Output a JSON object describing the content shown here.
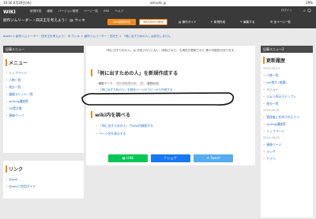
{
  "statusbar": {
    "time": "10:16  6月29日(木)",
    "url": "wikiwiki.jp",
    "battery": "29%"
  },
  "header": {
    "logo": "WIKI",
    "menu": [
      "新規作成",
      "編集",
      "バージョン管理",
      "ページ一覧",
      "RSS",
      "ヘルプ"
    ],
    "site_title": "創作ジムリーダー・四天王を考えよう！ @ ウィキ",
    "login": "ログイン",
    "btn_create": "wiki新規作成",
    "btn_manage": "無料版Wiki管理",
    "nav": [
      "操作ガイド",
      "新規作成",
      "編集する",
      "全ページ一覧"
    ]
  },
  "breadcrumb": "atwiki > 創作ジムリーダー・四天王を考えよう！ @ ウィキ > 創作ジムリーダー・四天王 > 「例に出すための人」は存在しません",
  "left_sidebar": {
    "head": "記事メニュー",
    "title": "メニュー",
    "items": [
      "トップページ",
      "人物一覧",
      "地方一覧",
      "議論スレッド一覧",
      "writing講座等",
      "SS置き場",
      "連絡ページ"
    ],
    "link_title": "リンク",
    "links": [
      "@wiki",
      "@wikiご利用ガイド"
    ]
  },
  "main": {
    "notice": "「例に出すための人」は 作成されていない（削除された）も現在が更新された 等の可能性があります。",
    "heading": "「例に出すための人」を新規作成する",
    "tag_label": "・編集モード:",
    "tags": [
      "ワープロモード",
      "ワ",
      "実物のみ"
    ],
    "copy_link": "「例に出すための人」を既存ページのコピーから作成する",
    "wiki_heading": "wiki内を調べる",
    "wiki_links": [
      "「例に出すための人」でWiki内検索する",
      "ページ名を表示する"
    ]
  },
  "share": {
    "line": "LINE",
    "facebook": "シェア",
    "twitter": "Tweet"
  },
  "right_sidebar": {
    "head": "記事メニュー2",
    "title": "更新履歴",
    "groups": [
      {
        "date": "2025-06-23",
        "items": [
          "人物一覧",
          "ver地方 (仮題)",
          "メニュー",
          "ジムリ四天王テンプレ",
          "地方一覧"
        ]
      },
      {
        "date": "2025-06-21",
        "items": [
          "管理者に任命された人へ",
          "writing講座等",
          "トップページ"
        ]
      },
      {
        "date": "2025-06-20",
        "items": [
          "連絡ページ",
          "ランサ",
          "ヤブリ"
        ]
      }
    ]
  },
  "colors": {
    "accent": "#f08a1c",
    "link": "#2a6fc4",
    "line": "#06c755",
    "facebook": "#1877f2",
    "twitter": "#55acee",
    "header": "#3a3a3a"
  }
}
